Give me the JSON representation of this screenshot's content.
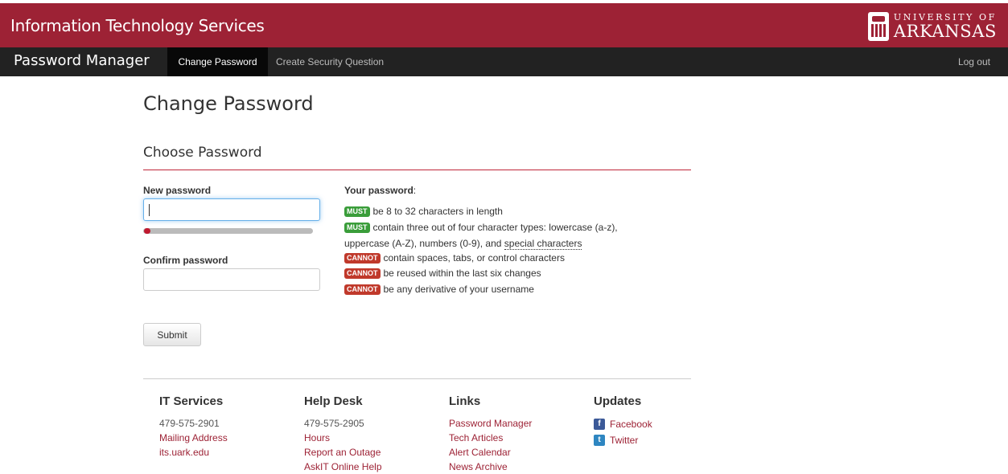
{
  "header": {
    "title": "Information Technology Services",
    "brand_top": "UNIVERSITY OF",
    "brand_bottom": "ARKANSAS"
  },
  "navbar": {
    "app_name": "Password Manager",
    "items": [
      {
        "label": "Change Password",
        "active": true
      },
      {
        "label": "Create Security Question",
        "active": false
      }
    ],
    "logout": "Log out"
  },
  "page": {
    "title": "Change Password",
    "section_title": "Choose Password"
  },
  "form": {
    "new_password_label": "New password",
    "new_password_value": "",
    "confirm_password_label": "Confirm password",
    "confirm_password_value": "",
    "submit_label": "Submit",
    "strength": 0.04
  },
  "rules": {
    "heading": "Your password",
    "heading_suffix": ":",
    "items": [
      {
        "badge": "MUST",
        "text": "be 8 to 32 characters in length"
      },
      {
        "badge": "MUST",
        "text": "contain three out of four character types: lowercase (a-z),",
        "text2": "uppercase (A-Z), numbers (0-9), and",
        "link": "special characters"
      },
      {
        "badge": "CANNOT",
        "text": "contain spaces, tabs, or control characters"
      },
      {
        "badge": "CANNOT",
        "text": "be reused within the last six changes"
      },
      {
        "badge": "CANNOT",
        "text": "be any derivative of your username"
      }
    ]
  },
  "footer": {
    "it_services": {
      "title": "IT Services",
      "phone": "479-575-2901",
      "links": [
        "Mailing Address",
        "its.uark.edu"
      ]
    },
    "help_desk": {
      "title": "Help Desk",
      "phone": "479-575-2905",
      "links": [
        "Hours",
        "Report an Outage",
        "AskIT Online Help"
      ]
    },
    "links": {
      "title": "Links",
      "links": [
        "Password Manager",
        "Tech Articles",
        "Alert Calendar",
        "News Archive"
      ]
    },
    "updates": {
      "title": "Updates",
      "facebook": "Facebook",
      "twitter": "Twitter"
    }
  },
  "colors": {
    "brand": "#9d2235",
    "nav": "#222222",
    "must": "#3a9d3a",
    "cannot": "#c0392b"
  }
}
